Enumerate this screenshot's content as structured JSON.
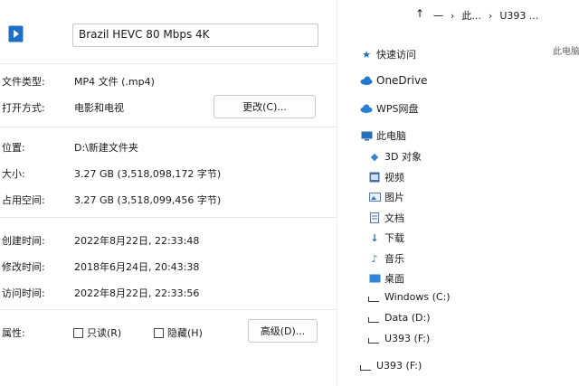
{
  "properties": {
    "file_name": "Brazil HEVC 80 Mbps 4K",
    "rows": {
      "type": {
        "label": "文件类型:",
        "value": "MP4 文件 (.mp4)"
      },
      "open_with": {
        "label": "打开方式:",
        "value": "电影和电视"
      },
      "location": {
        "label": "位置:",
        "value": "D:\\新建文件夹"
      },
      "size": {
        "label": "大小:",
        "value": "3.27 GB (3,518,098,172 字节)"
      },
      "disk_size": {
        "label": "占用空间:",
        "value": "3.27 GB (3,518,099,456 字节)"
      },
      "created": {
        "label": "创建时间:",
        "value": "2022年8月22日, 22:33:48"
      },
      "modified": {
        "label": "修改时间:",
        "value": "2018年6月24日, 20:43:38"
      },
      "accessed": {
        "label": "访问时间:",
        "value": "2022年8月22日, 22:33:56"
      },
      "attrs": {
        "label": "属性:"
      }
    },
    "change_button": "更改(C)...",
    "readonly_label": "只读(R)",
    "hidden_label": "隐藏(H)",
    "advanced_button": "高级(D)..."
  },
  "explorer": {
    "breadcrumb": {
      "part1": "此...",
      "part2": "U393 ..."
    },
    "pc_label": "此电脑",
    "nav": [
      {
        "label": "快速访问",
        "icon": "star-icon"
      },
      {
        "label": "OneDrive",
        "icon": "cloud-icon"
      },
      {
        "label": "WPS网盘",
        "icon": "cloud-icon"
      },
      {
        "label": "此电脑",
        "icon": "computer-icon"
      },
      {
        "label": "3D 对象",
        "icon": "cube-icon"
      },
      {
        "label": "视频",
        "icon": "video-icon"
      },
      {
        "label": "图片",
        "icon": "picture-icon"
      },
      {
        "label": "文档",
        "icon": "document-icon"
      },
      {
        "label": "下载",
        "icon": "download-icon"
      },
      {
        "label": "音乐",
        "icon": "music-icon"
      },
      {
        "label": "桌面",
        "icon": "desktop-icon"
      },
      {
        "label": "Windows (C:)",
        "icon": "drive-icon"
      },
      {
        "label": "Data (D:)",
        "icon": "drive-icon"
      },
      {
        "label": "U393 (F:)",
        "icon": "drive-icon"
      },
      {
        "label": "U393 (F:)",
        "icon": "drive-icon"
      }
    ]
  }
}
